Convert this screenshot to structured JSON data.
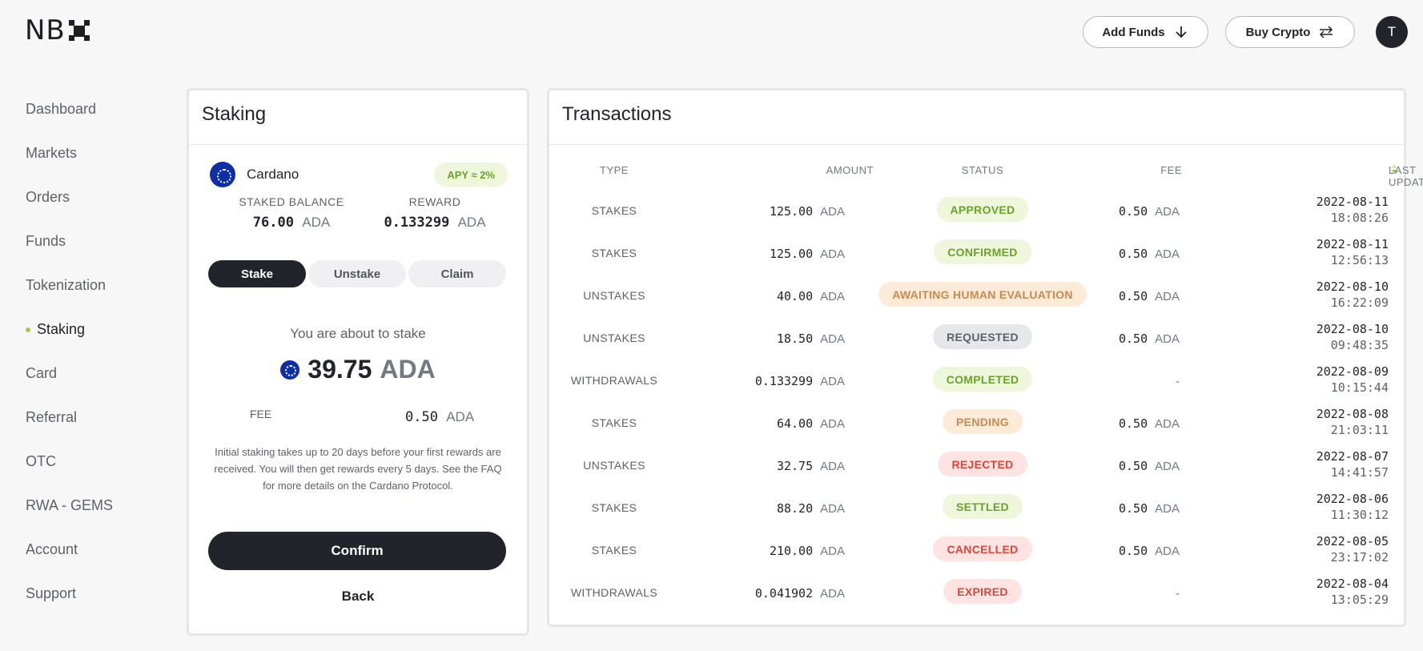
{
  "brand": {
    "logo": "NB"
  },
  "header": {
    "add_funds_label": "Add Funds",
    "buy_crypto_label": "Buy Crypto",
    "avatar_initial": "T"
  },
  "sidebar": {
    "items": [
      {
        "label": "Dashboard",
        "active": false
      },
      {
        "label": "Markets",
        "active": false
      },
      {
        "label": "Orders",
        "active": false
      },
      {
        "label": "Funds",
        "active": false
      },
      {
        "label": "Tokenization",
        "active": false
      },
      {
        "label": "Staking",
        "active": true
      },
      {
        "label": "Card",
        "active": false
      },
      {
        "label": "Referral",
        "active": false
      },
      {
        "label": "OTC",
        "active": false
      },
      {
        "label": "RWA - GEMS",
        "active": false
      },
      {
        "label": "Account",
        "active": false
      },
      {
        "label": "Support",
        "active": false
      }
    ]
  },
  "staking": {
    "title": "Staking",
    "coin_name": "Cardano",
    "apy": "APY ≈ 2%",
    "staked_balance_label": "STAKED BALANCE",
    "staked_balance_value": "76.00",
    "reward_label": "REWARD",
    "reward_value": "0.133299",
    "unit": "ADA",
    "tabs": [
      "Stake",
      "Unstake",
      "Claim"
    ],
    "active_tab": "Stake",
    "about_text": "You are about to stake",
    "amount": "39.75",
    "fee_label": "FEE",
    "fee_value": "0.50",
    "note": "Initial staking takes up to 20 days before your first rewards are received. You will then get rewards every 5 days. See the FAQ for more details on the Cardano Protocol.",
    "confirm_label": "Confirm",
    "back_label": "Back"
  },
  "transactions": {
    "title": "Transactions",
    "columns": {
      "type": "TYPE",
      "amount": "AMOUNT",
      "status": "STATUS",
      "fee": "FEE",
      "last_updated": "LAST UPDATED"
    },
    "unit": "ADA",
    "rows": [
      {
        "type": "STAKES",
        "amount": "125.00",
        "status": "APPROVED",
        "fee": "0.50",
        "date": "2022-08-11",
        "time": "18:08:26"
      },
      {
        "type": "STAKES",
        "amount": "125.00",
        "status": "CONFIRMED",
        "fee": "0.50",
        "date": "2022-08-11",
        "time": "12:56:13"
      },
      {
        "type": "UNSTAKES",
        "amount": "40.00",
        "status": "AWAITING HUMAN EVALUATION",
        "fee": "0.50",
        "date": "2022-08-10",
        "time": "16:22:09"
      },
      {
        "type": "UNSTAKES",
        "amount": "18.50",
        "status": "REQUESTED",
        "fee": "0.50",
        "date": "2022-08-10",
        "time": "09:48:35"
      },
      {
        "type": "WITHDRAWALS",
        "amount": "0.133299",
        "status": "COMPLETED",
        "fee": "-",
        "date": "2022-08-09",
        "time": "10:15:44"
      },
      {
        "type": "STAKES",
        "amount": "64.00",
        "status": "PENDING",
        "fee": "0.50",
        "date": "2022-08-08",
        "time": "21:03:11"
      },
      {
        "type": "UNSTAKES",
        "amount": "32.75",
        "status": "REJECTED",
        "fee": "0.50",
        "date": "2022-08-07",
        "time": "14:41:57"
      },
      {
        "type": "STAKES",
        "amount": "88.20",
        "status": "SETTLED",
        "fee": "0.50",
        "date": "2022-08-06",
        "time": "11:30:12"
      },
      {
        "type": "STAKES",
        "amount": "210.00",
        "status": "CANCELLED",
        "fee": "0.50",
        "date": "2022-08-05",
        "time": "23:17:02"
      },
      {
        "type": "WITHDRAWALS",
        "amount": "0.041902",
        "status": "EXPIRED",
        "fee": "-",
        "date": "2022-08-04",
        "time": "13:05:29"
      }
    ]
  },
  "status_colors": {
    "APPROVED": {
      "bg": "#eef6dc",
      "fg": "#6aa22a"
    },
    "CONFIRMED": {
      "bg": "#eef6dc",
      "fg": "#6aa22a"
    },
    "COMPLETED": {
      "bg": "#eef6dc",
      "fg": "#6aa22a"
    },
    "SETTLED": {
      "bg": "#eef6dc",
      "fg": "#6aa22a"
    },
    "AWAITING HUMAN EVALUATION": {
      "bg": "#fcebd9",
      "fg": "#c98a4e"
    },
    "PENDING": {
      "bg": "#fcebd9",
      "fg": "#c98a4e"
    },
    "REQUESTED": {
      "bg": "#e6e7eb",
      "fg": "#5f6169"
    },
    "REJECTED": {
      "bg": "#fde4e2",
      "fg": "#d9473a"
    },
    "CANCELLED": {
      "bg": "#fde4e2",
      "fg": "#d9473a"
    },
    "EXPIRED": {
      "bg": "#fde4e2",
      "fg": "#d9473a"
    }
  }
}
